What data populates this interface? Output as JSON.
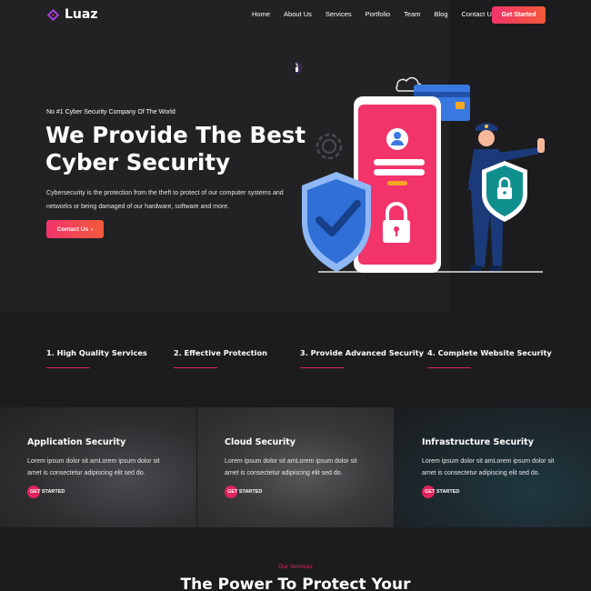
{
  "header": {
    "logo_text": "Luaz",
    "nav": [
      "Home",
      "About Us",
      "Services",
      "Portfolio",
      "Team",
      "Blog",
      "Contact Us"
    ],
    "cta_label": "Get Started"
  },
  "hero": {
    "subtitle": "No #1 Cyber Security Company Of The World",
    "title_line1": "We Provide The Best",
    "title_line2": "Cyber Security",
    "description": "Cybersecurity is the protection from the theft to protect of our computer systems and networks or being damaged of our hardware, software and more.",
    "button_label": "Contact Us"
  },
  "features": [
    "1. High Quality Services",
    "2. Effective Protection",
    "3. Provide Advanced Security",
    "4. Complete Website Security"
  ],
  "cards": [
    {
      "title": "Application Security",
      "description": "Lorem ipsum dolor sit amLorem ipsum dolor sit amet is consectetur adipiscing elit sed do.",
      "button": "GET STARTED"
    },
    {
      "title": "Cloud Security",
      "description": "Lorem ipsum dolor sit amLorem ipsum dolor sit amet is consectetur adipiscing elit sed do.",
      "button": "GET STARTED"
    },
    {
      "title": "Infrastructure Security",
      "description": "Lorem ipsum dolor sit amLorem ipsum dolor sit amet is consectetur adipiscing elit sed do.",
      "button": "GET STARTED"
    }
  ],
  "services": {
    "label": "Our Services",
    "title": "The Power To Protect Your"
  },
  "colors": {
    "accent": "#e0245e",
    "background": "#1c1c1e",
    "hero_panel": "#222224",
    "phone": "#f2346b",
    "shield": "#2f6fd6",
    "shield_teal": "#108f8f"
  }
}
